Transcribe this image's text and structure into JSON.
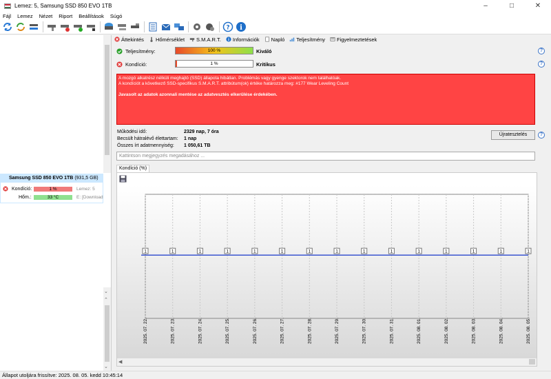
{
  "window": {
    "title": "Lemez: 5, Samsung SSD 850 EVO 1TB"
  },
  "menu": [
    "Fájl",
    "Lemez",
    "Nézet",
    "Riport",
    "Beállítások",
    "Súgó"
  ],
  "tabs": [
    {
      "label": "Áttekintés",
      "icon": "error-icon",
      "color": "#e03b3b"
    },
    {
      "label": "Hőmérséklet",
      "icon": "thermometer-icon",
      "color": "#666666"
    },
    {
      "label": "S.M.A.R.T.",
      "icon": "smart-icon",
      "color": "#555555"
    },
    {
      "label": "Információk",
      "icon": "info-icon",
      "color": "#1f6fc9"
    },
    {
      "label": "Napló",
      "icon": "log-icon",
      "color": "#888888"
    },
    {
      "label": "Teljesítmény",
      "icon": "performance-icon",
      "color": "#4a8fd8"
    },
    {
      "label": "Figyelmeztetések",
      "icon": "warning-icon",
      "color": "#777777"
    }
  ],
  "overview": {
    "performance": {
      "label": "Teljesítmény:",
      "value": "100 %",
      "fill": 1.0,
      "status": "Kiváló"
    },
    "health": {
      "label": "Kondíció:",
      "value": "1 %",
      "fill": 0.01,
      "status": "Kritikus"
    }
  },
  "alert": {
    "line1": "A mozgó alkatrész nélküli meghajtó (SSD) állapota hibátlan. Problémás vagy gyenge szektorok nem találhatóak.",
    "line2": "A kondíciót a következő SSD-specifikus S.M.A.R.T. attribútum(ok) értéke határozza meg:  #177 Wear Leveling Count",
    "line3": "Javasolt az adatok azonnali mentése az adatvesztés elkerülése érdekében."
  },
  "info": {
    "uptime_label": "Működési idő:",
    "uptime_value": "2329 nap, 7 óra",
    "remaining_label": "Becsült hátralévő élettartam:",
    "remaining_value": "1 nap",
    "written_label": "Összes írt adatmennyiség:",
    "written_value": "1 050,61 TB"
  },
  "retest_label": "Újratesztelés",
  "note_placeholder": "Kattintson megjegyzés megadásához ...",
  "graph_tab_label": "Kondíció  (%)",
  "disk_card": {
    "name": "Samsung SSD 850 EVO 1TB",
    "size": "(931,5 GB)",
    "health_label": "Kondíció:",
    "health_value": "1 %",
    "temp_label": "Hőm.:",
    "temp_value": "33 °C",
    "right1": "Lemez: 5",
    "right2": "E: [Download"
  },
  "chart_data": {
    "type": "line",
    "x": [
      "2025. 07. 22.",
      "2025. 07. 23.",
      "2025. 07. 24.",
      "2025. 07. 25.",
      "2025. 07. 26.",
      "2025. 07. 27.",
      "2025. 07. 28.",
      "2025. 07. 29.",
      "2025. 07. 30.",
      "2025. 07. 31.",
      "2025. 08. 01.",
      "2025. 08. 02.",
      "2025. 08. 03.",
      "2025. 08. 04.",
      "2025. 08. 05."
    ],
    "values": [
      1,
      1,
      1,
      1,
      1,
      1,
      1,
      1,
      1,
      1,
      1,
      1,
      1,
      1,
      1
    ],
    "ylim": [
      0,
      100
    ],
    "grid": true,
    "line_color": "#3a55d0"
  },
  "statusbar": {
    "text": "Állapot utoljára frissítve: 2025. 08. 05. kedd 10:45:14"
  }
}
